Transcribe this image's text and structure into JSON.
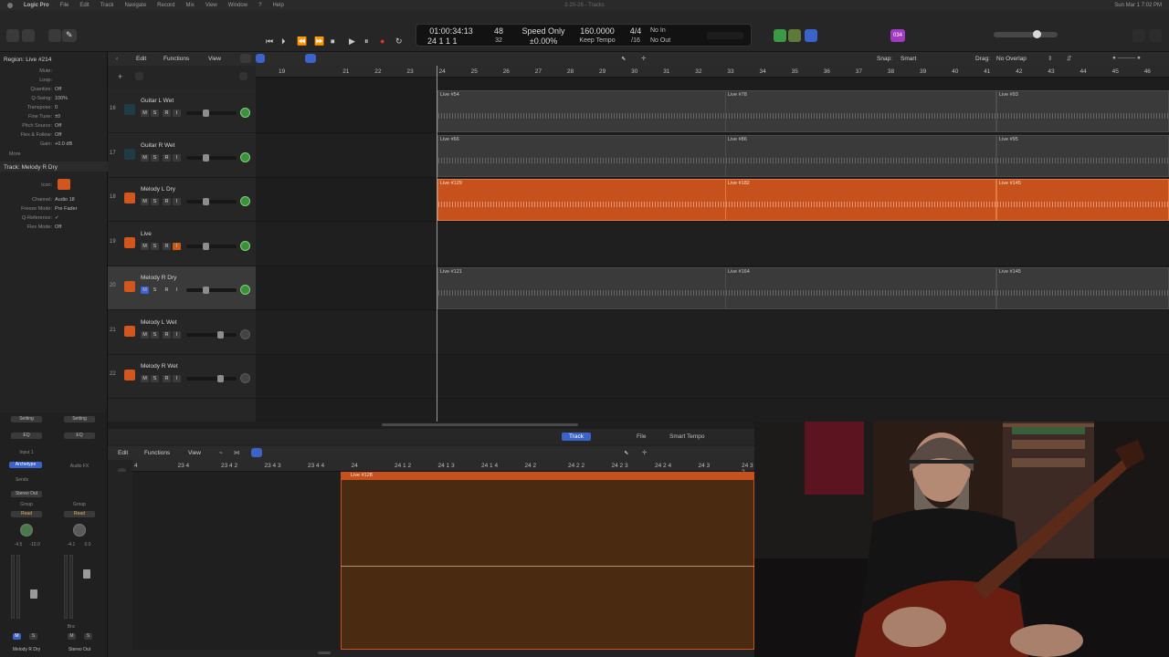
{
  "menubar": {
    "app": "Logic Pro",
    "items": [
      "File",
      "Edit",
      "Track",
      "Navigate",
      "Record",
      "Mix",
      "View",
      "Window",
      "?",
      "Help"
    ],
    "doc_title": "2-20-26 - Tracks",
    "clock": "Sun Mar 1  7:02 PM"
  },
  "lcd": {
    "time": "01:00:34:13",
    "bars": "24  1  1       1",
    "tempo_big": "48",
    "tempo_small": "32",
    "speed_mode": "Speed Only",
    "speed_value": "±0.00%",
    "bpm": "160.0000",
    "bpm_mode": "Keep Tempo",
    "sig_top": "4/4",
    "sig_bottom": "/16",
    "in": "No In",
    "out": "No Out"
  },
  "controlbar": {
    "count_badge": "034"
  },
  "inspector": {
    "region_title": "Region:  Live #214",
    "rows": [
      {
        "k": "Mute:",
        "v": ""
      },
      {
        "k": "Loop:",
        "v": ""
      },
      {
        "k": "Quantize:",
        "v": "Off"
      },
      {
        "k": "Q-Swing:",
        "v": "100%"
      },
      {
        "k": "Transpose:",
        "v": "0"
      },
      {
        "k": "Fine Tune:",
        "v": "±0"
      },
      {
        "k": "Pitch Source:",
        "v": "Off"
      },
      {
        "k": "Flex & Follow:",
        "v": "Off"
      },
      {
        "k": "Gain:",
        "v": "+0.0 dB"
      }
    ],
    "more": "More",
    "track_title": "Track:  Melody R Dry",
    "track_rows": [
      {
        "k": "Icon:",
        "v": ""
      },
      {
        "k": "Channel:",
        "v": "Audio 18"
      },
      {
        "k": "Freeze Mode:",
        "v": "Pre Fader"
      },
      {
        "k": "Q-Reference:",
        "v": "✓"
      },
      {
        "k": "Flex Mode:",
        "v": "Off"
      }
    ]
  },
  "arrange_bar": {
    "edit": "Edit",
    "functions": "Functions",
    "view": "View",
    "snap_label": "Snap:",
    "snap_value": "Smart",
    "drag_label": "Drag:",
    "drag_value": "No Overlap"
  },
  "ruler": {
    "marks": [
      "19",
      "21",
      "22",
      "23",
      "24",
      "25",
      "26",
      "27",
      "28",
      "29",
      "30",
      "31",
      "32",
      "33",
      "34",
      "35",
      "36",
      "37",
      "38",
      "39",
      "40",
      "41",
      "42",
      "43",
      "44",
      "45",
      "46"
    ]
  },
  "tracks": [
    {
      "num": "16",
      "name": "Guitar L Wet",
      "icon": "teal",
      "pan": "green",
      "sel": false,
      "rec": false
    },
    {
      "num": "17",
      "name": "Guitar R Wet",
      "icon": "teal",
      "pan": "green",
      "sel": false,
      "rec": false
    },
    {
      "num": "18",
      "name": "Melody L Dry",
      "icon": "orange",
      "pan": "green",
      "sel": false,
      "rec": false
    },
    {
      "num": "19",
      "name": "Live",
      "icon": "orange",
      "pan": "green",
      "sel": false,
      "rec": true
    },
    {
      "num": "20",
      "name": "Melody R Dry",
      "icon": "orange",
      "pan": "green",
      "sel": true,
      "rec": false
    },
    {
      "num": "21",
      "name": "Melody L Wet",
      "icon": "orange",
      "pan": "gray",
      "sel": false,
      "rec": false
    },
    {
      "num": "22",
      "name": "Melody R Wet",
      "icon": "orange",
      "pan": "gray",
      "sel": false,
      "rec": false
    }
  ],
  "regions": [
    [
      {
        "name": "Live #54"
      },
      {
        "name": "Live #78"
      },
      {
        "name": "Live #93"
      }
    ],
    [
      {
        "name": "Live #66"
      },
      {
        "name": "Live #86"
      },
      {
        "name": "Live #95"
      }
    ],
    [
      {
        "name": "Live #129"
      },
      {
        "name": "Live #182"
      },
      {
        "name": "Live #145"
      }
    ],
    [],
    [
      {
        "name": "Live #121"
      },
      {
        "name": "Live #164"
      },
      {
        "name": "Live #145"
      }
    ],
    [],
    []
  ],
  "editor": {
    "tabs": [
      "Track",
      "File",
      "Smart Tempo"
    ],
    "edit": "Edit",
    "functions": "Functions",
    "view": "View",
    "ruler": [
      "4",
      "23 4",
      "23 4 2",
      "23 4 3",
      "23 4 4",
      "24",
      "24 1 2",
      "24 1 3",
      "24 1 4",
      "24 2",
      "24 2 2",
      "24 2 3",
      "24 2 4",
      "24 3",
      "24 3 2"
    ],
    "region_name": "Live #128"
  },
  "strips": {
    "left": {
      "setting": "Setting",
      "eq": "EQ",
      "input": "Input 1",
      "plugin": "Archetype",
      "sends": "Sends",
      "output": "Stereo Out",
      "group": "Group",
      "auto": "Read",
      "db_a": "-4.5",
      "db_b": "-10.0",
      "name": "Melody R Dry"
    },
    "right": {
      "setting": "Setting",
      "eq": "EQ",
      "input": "",
      "plugin": "Audio FX",
      "sends": "",
      "output": "",
      "group": "Group",
      "auto": "Read",
      "db_a": "-4.1",
      "db_b": "0.0",
      "name": "Stereo Out",
      "bnc": "Bnc"
    }
  },
  "colors": {
    "region_orange": "#c6511d",
    "accent_blue": "#3b63c9",
    "rec_red": "#e0352b",
    "cycle_green": "#3c9a46"
  }
}
